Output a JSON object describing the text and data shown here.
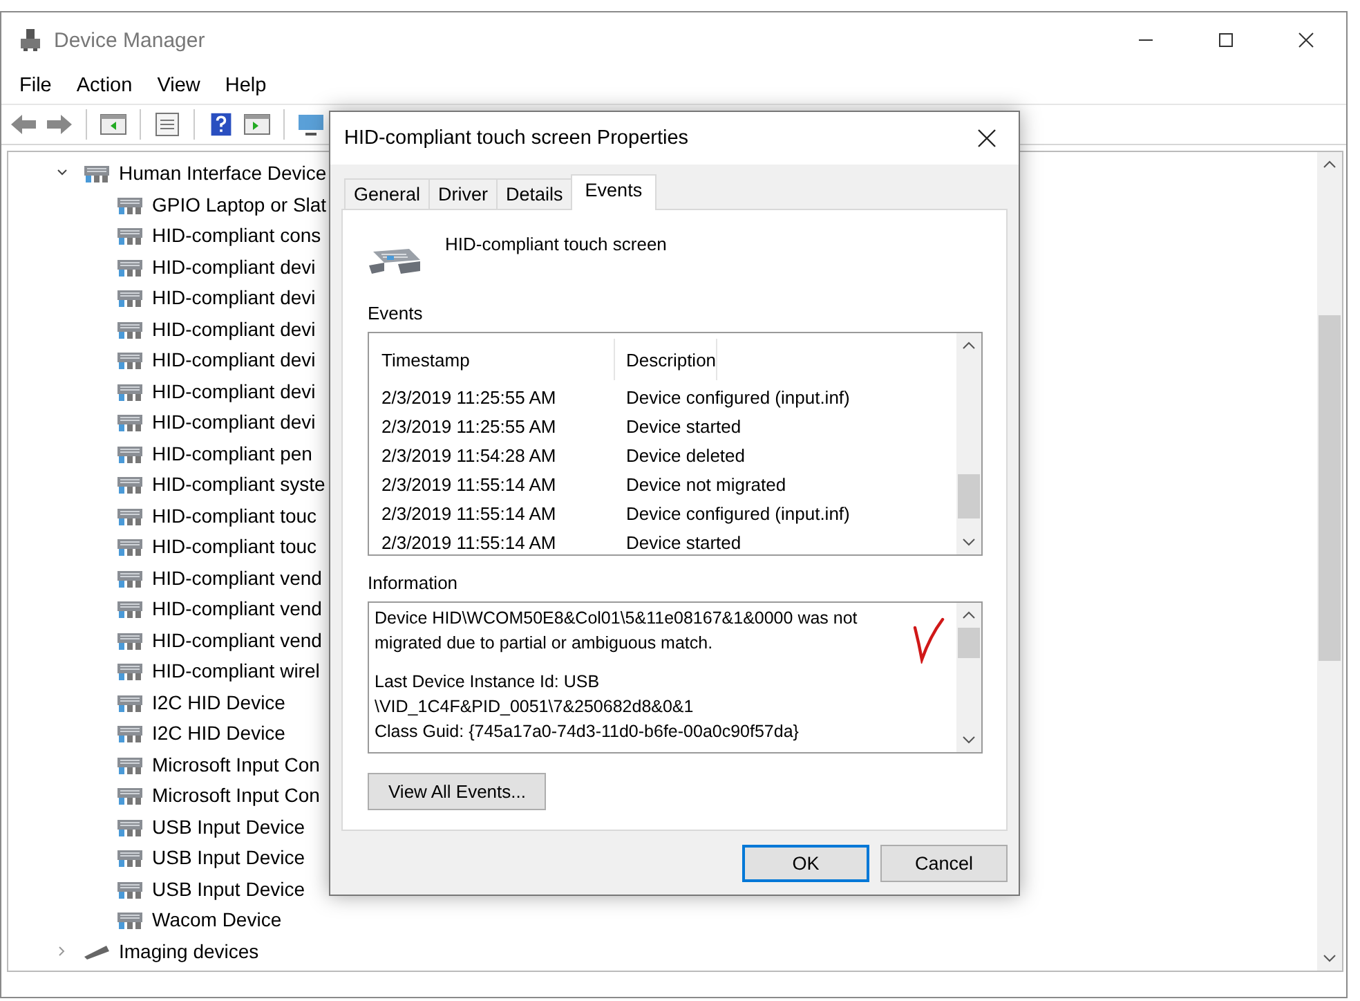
{
  "window": {
    "title": "Device Manager"
  },
  "menu": [
    "File",
    "Action",
    "View",
    "Help"
  ],
  "tree": {
    "category": {
      "label": "Human Interface Device",
      "expanded": true,
      "children": [
        {
          "label": "GPIO Laptop or Slat"
        },
        {
          "label": "HID-compliant cons"
        },
        {
          "label": "HID-compliant devi"
        },
        {
          "label": "HID-compliant devi"
        },
        {
          "label": "HID-compliant devi"
        },
        {
          "label": "HID-compliant devi"
        },
        {
          "label": "HID-compliant devi"
        },
        {
          "label": "HID-compliant devi"
        },
        {
          "label": "HID-compliant pen"
        },
        {
          "label": "HID-compliant syste"
        },
        {
          "label": "HID-compliant touc"
        },
        {
          "label": "HID-compliant touc"
        },
        {
          "label": "HID-compliant vend"
        },
        {
          "label": "HID-compliant vend"
        },
        {
          "label": "HID-compliant vend"
        },
        {
          "label": "HID-compliant wirel"
        },
        {
          "label": "I2C HID Device"
        },
        {
          "label": "I2C HID Device"
        },
        {
          "label": "Microsoft Input Con"
        },
        {
          "label": "Microsoft Input Con"
        },
        {
          "label": "USB Input Device"
        },
        {
          "label": "USB Input Device"
        },
        {
          "label": "USB Input Device"
        },
        {
          "label": "Wacom Device"
        }
      ]
    },
    "next_category": {
      "label": "Imaging devices",
      "expanded": false
    }
  },
  "dialog": {
    "title": "HID-compliant touch screen Properties",
    "tabs": [
      {
        "label": "General",
        "selected": false
      },
      {
        "label": "Driver",
        "selected": false
      },
      {
        "label": "Details",
        "selected": false
      },
      {
        "label": "Events",
        "selected": true
      }
    ],
    "device_name": "HID-compliant touch screen",
    "events_label": "Events",
    "events_table": {
      "columns": [
        "Timestamp",
        "Description"
      ],
      "rows": [
        {
          "timestamp": "2/3/2019 11:25:55 AM",
          "description": "Device configured (input.inf)"
        },
        {
          "timestamp": "2/3/2019 11:25:55 AM",
          "description": "Device started"
        },
        {
          "timestamp": "2/3/2019 11:54:28 AM",
          "description": "Device deleted"
        },
        {
          "timestamp": "2/3/2019 11:55:14 AM",
          "description": "Device not migrated"
        },
        {
          "timestamp": "2/3/2019 11:55:14 AM",
          "description": "Device configured (input.inf)"
        },
        {
          "timestamp": "2/3/2019 11:55:14 AM",
          "description": "Device started"
        }
      ]
    },
    "information_label": "Information",
    "information_paragraphs": [
      [
        "Device HID\\WCOM50E8&Col01\\5&11e08167&1&0000 was not",
        "migrated due to partial or ambiguous match."
      ],
      [
        "Last Device Instance Id: USB",
        "\\VID_1C4F&PID_0051\\7&250682d8&0&1",
        "Class Guid: {745a17a0-74d3-11d0-b6fe-00a0c90f57da}"
      ]
    ],
    "view_all_button": "View All Events...",
    "buttons": [
      "OK",
      "Cancel"
    ]
  }
}
